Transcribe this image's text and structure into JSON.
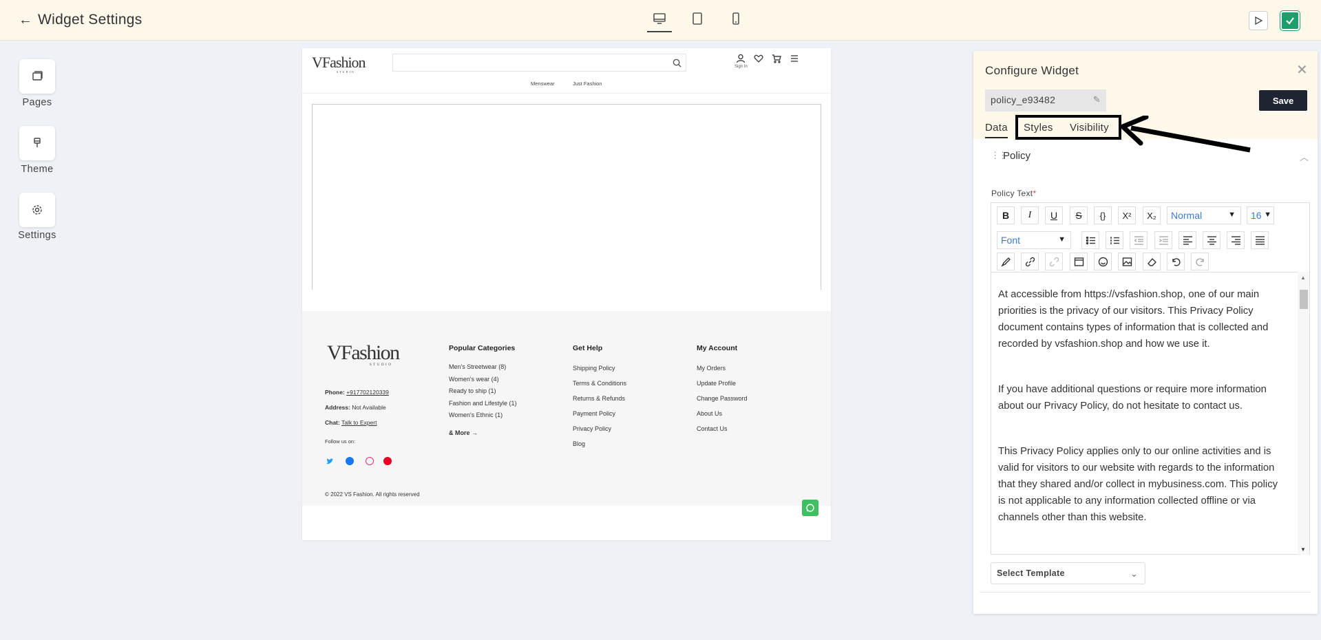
{
  "topbar": {
    "title": "Widget Settings",
    "devices": [
      {
        "name": "desktop",
        "active": true
      },
      {
        "name": "tablet",
        "active": false
      },
      {
        "name": "mobile",
        "active": false
      }
    ]
  },
  "rail": {
    "items": [
      {
        "label": "Pages"
      },
      {
        "label": "Theme"
      },
      {
        "label": "Settings"
      }
    ]
  },
  "preview": {
    "logo": "VFashion",
    "logo_tag": "STUDIO",
    "sign_in": "Sign In",
    "nav": [
      "Menswear",
      "Just Fashion"
    ],
    "footer": {
      "phone_label": "Phone:",
      "phone": "+917702120339",
      "address_label": "Address:",
      "address": "Not Available",
      "chat_label": "Chat:",
      "chat": "Talk to Expert",
      "follow": "Follow us on:",
      "col1_head": "Popular Categories",
      "col1": [
        "Men's Streetwear (8)",
        "Women's wear (4)",
        "Ready to ship (1)",
        "Fashion and Lifestyle (1)",
        "Women's Ethnic (1)"
      ],
      "more": "& More →",
      "col2_head": "Get Help",
      "col2": [
        "Shipping Policy",
        "Terms & Conditions",
        "Returns & Refunds",
        "Payment Policy",
        "Privacy Policy",
        "Blog"
      ],
      "col3_head": "My Account",
      "col3": [
        "My Orders",
        "Update Profile",
        "Change Password",
        "About Us",
        "Contact Us"
      ],
      "copyright": "© 2022 VS Fashion. All rights reserved"
    }
  },
  "panel": {
    "title": "Configure Widget",
    "widget_name": "policy_e93482",
    "save": "Save",
    "tabs": [
      "Data",
      "Styles",
      "Visibility"
    ],
    "section": "Policy",
    "field_label": "Policy Text",
    "required_mark": "*",
    "toolbar": {
      "heading": "Normal",
      "size": "16",
      "font": "Font"
    },
    "paragraphs": [
      "At  accessible from https://vsfashion.shop, one of our main priorities is the privacy of our visitors. This Privacy Policy document contains types of information that is collected and recorded by vsfashion.shop and how we use it.",
      "If you have additional questions or require more information about our Privacy Policy, do not hesitate to contact us.",
      "This Privacy Policy applies only to our online activities and is valid for visitors to our website with regards to the information that they shared and/or collect in mybusiness.com. This policy is not applicable to any information collected offline or via channels other than this website."
    ],
    "template": "Select Template"
  },
  "colors": {
    "topbar_bg": "#fdf8ea",
    "save_bg": "#1f2433",
    "publish_green": "#1e9e6a",
    "link_blue": "#3a7bd5"
  }
}
